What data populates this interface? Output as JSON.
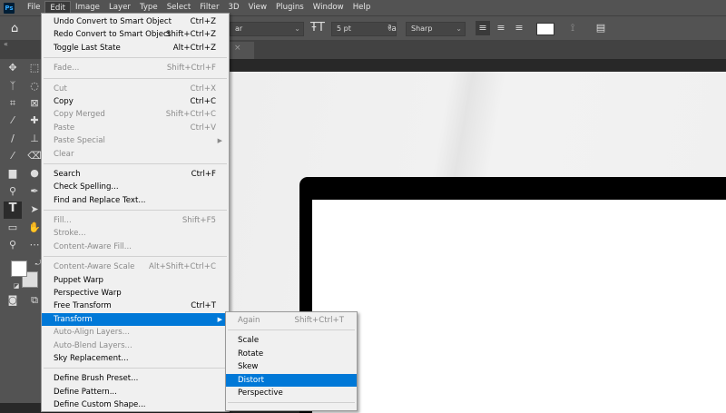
{
  "app": {
    "logo": "Ps"
  },
  "menubar": [
    "File",
    "Edit",
    "Image",
    "Layer",
    "Type",
    "Select",
    "Filter",
    "3D",
    "View",
    "Plugins",
    "Window",
    "Help"
  ],
  "options": {
    "font_style": "ar",
    "font_size": "5 pt",
    "antialias": "Sharp"
  },
  "edit_menu": [
    {
      "label": "Undo Convert to Smart Object",
      "shortcut": "Ctrl+Z"
    },
    {
      "label": "Redo Convert to Smart Object",
      "shortcut": "Shift+Ctrl+Z"
    },
    {
      "label": "Toggle Last State",
      "shortcut": "Alt+Ctrl+Z"
    },
    {
      "sep": true
    },
    {
      "label": "Fade...",
      "shortcut": "Shift+Ctrl+F",
      "disabled": true
    },
    {
      "sep": true
    },
    {
      "label": "Cut",
      "shortcut": "Ctrl+X",
      "disabled": true
    },
    {
      "label": "Copy",
      "shortcut": "Ctrl+C"
    },
    {
      "label": "Copy Merged",
      "shortcut": "Shift+Ctrl+C",
      "disabled": true
    },
    {
      "label": "Paste",
      "shortcut": "Ctrl+V",
      "disabled": true
    },
    {
      "label": "Paste Special",
      "submenu": true,
      "disabled": true
    },
    {
      "label": "Clear",
      "disabled": true
    },
    {
      "sep": true
    },
    {
      "label": "Search",
      "shortcut": "Ctrl+F"
    },
    {
      "label": "Check Spelling..."
    },
    {
      "label": "Find and Replace Text..."
    },
    {
      "sep": true
    },
    {
      "label": "Fill...",
      "shortcut": "Shift+F5",
      "disabled": true
    },
    {
      "label": "Stroke...",
      "disabled": true
    },
    {
      "label": "Content-Aware Fill...",
      "disabled": true
    },
    {
      "sep": true
    },
    {
      "label": "Content-Aware Scale",
      "shortcut": "Alt+Shift+Ctrl+C",
      "disabled": true
    },
    {
      "label": "Puppet Warp"
    },
    {
      "label": "Perspective Warp"
    },
    {
      "label": "Free Transform",
      "shortcut": "Ctrl+T"
    },
    {
      "label": "Transform",
      "submenu": true,
      "highlighted": true
    },
    {
      "label": "Auto-Align Layers...",
      "disabled": true
    },
    {
      "label": "Auto-Blend Layers...",
      "disabled": true
    },
    {
      "label": "Sky Replacement..."
    },
    {
      "sep": true
    },
    {
      "label": "Define Brush Preset..."
    },
    {
      "label": "Define Pattern..."
    },
    {
      "label": "Define Custom Shape..."
    }
  ],
  "transform_menu": [
    {
      "label": "Again",
      "shortcut": "Shift+Ctrl+T",
      "disabled": true
    },
    {
      "sep": true
    },
    {
      "label": "Scale"
    },
    {
      "label": "Rotate"
    },
    {
      "label": "Skew"
    },
    {
      "label": "Distort",
      "highlighted": true
    },
    {
      "label": "Perspective"
    },
    {
      "sep": true
    }
  ],
  "colors": {
    "highlight": "#0078d7",
    "panel": "#535353",
    "menu_bg": "#f0f0f0"
  }
}
